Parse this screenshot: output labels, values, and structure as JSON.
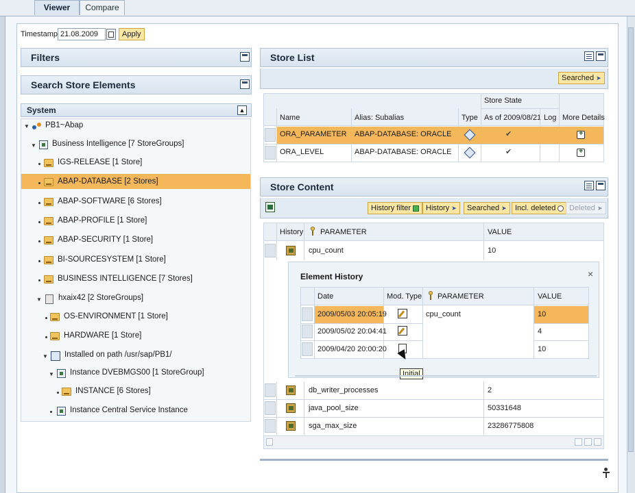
{
  "tabs": [
    {
      "label": "Viewer",
      "active": true
    },
    {
      "label": "Compare",
      "active": false
    }
  ],
  "timestamp": {
    "label": "Timestamp:",
    "value": "21.08.2009",
    "apply_label": "Apply"
  },
  "left_panels": {
    "filters": "Filters",
    "search": "Search Store Elements"
  },
  "tree": {
    "header": "System",
    "root": "PB1~Abap",
    "items": [
      {
        "label": "Business Intelligence [7 StoreGroups]"
      },
      {
        "label": "IGS-RELEASE [1 Store]"
      },
      {
        "label": "ABAP-DATABASE [2 Stores]",
        "selected": true
      },
      {
        "label": "ABAP-SOFTWARE [6 Stores]"
      },
      {
        "label": "ABAP-PROFILE [1 Store]"
      },
      {
        "label": "ABAP-SECURITY [1 Store]"
      },
      {
        "label": "BI-SOURCESYSTEM [1 Store]"
      },
      {
        "label": "BUSINESS INTELLIGENCE [7 Stores]"
      },
      {
        "label": "hxaix42 [2 StoreGroups]"
      },
      {
        "label": "OS-ENVIRONMENT [1 Store]"
      },
      {
        "label": "HARDWARE [1 Store]"
      },
      {
        "label": "Installed on path /usr/sap/PB1/"
      },
      {
        "label": "Instance DVEBMGS00 [1 StoreGroup]"
      },
      {
        "label": "INSTANCE [6 Stores]"
      },
      {
        "label": "Instance Central Service Instance"
      }
    ]
  },
  "store_list": {
    "title": "Store List",
    "searched_label": "Searched",
    "group_header": "Store State",
    "columns": [
      "Name",
      "Alias: Subalias",
      "Type",
      "As of 2009/08/21",
      "Log",
      "More Details"
    ],
    "rows": [
      {
        "name": "ORA_PARAMETER",
        "alias": "ABAP-DATABASE: ORACLE",
        "state": "✔",
        "selected": true
      },
      {
        "name": "ORA_LEVEL",
        "alias": "ABAP-DATABASE: ORACLE",
        "state": "✔",
        "selected": false
      }
    ]
  },
  "store_content": {
    "title": "Store Content",
    "buttons": [
      {
        "label": "History filter"
      },
      {
        "label": "History"
      },
      {
        "label": "Searched"
      },
      {
        "label": "Incl. deleted"
      },
      {
        "label": "Deleted",
        "disabled": true
      }
    ],
    "columns": [
      "History",
      "PARAMETER",
      "VALUE"
    ],
    "rows_top": [
      {
        "parameter": "cpu_count",
        "value": "10"
      }
    ],
    "rows_bottom": [
      {
        "parameter": "db_writer_processes",
        "value": "2"
      },
      {
        "parameter": "java_pool_size",
        "value": "50331648"
      },
      {
        "parameter": "sga_max_size",
        "value": "23286775808"
      }
    ]
  },
  "element_history": {
    "title": "Element History",
    "close": "×",
    "columns": [
      "Date",
      "Mod. Type",
      "PARAMETER",
      "VALUE"
    ],
    "parameter": "cpu_count",
    "rows": [
      {
        "date": "2009/05/03 20:05:19",
        "value": "10",
        "selected": true
      },
      {
        "date": "2009/05/02 20:04:41",
        "value": "4",
        "selected": false
      },
      {
        "date": "2009/04/20 20:00:20",
        "value": "10",
        "selected": false
      }
    ],
    "tooltip": "Initial"
  },
  "colors": {
    "selection": "#f4b85b",
    "button": "#fbe7a3",
    "header": "#d7e3ef"
  }
}
